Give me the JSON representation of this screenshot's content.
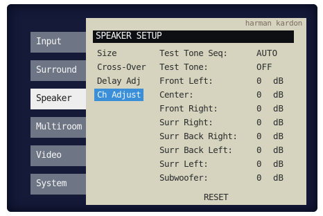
{
  "sidebar": {
    "items": [
      {
        "label": "Input"
      },
      {
        "label": "Surround"
      },
      {
        "label": "Speaker"
      },
      {
        "label": "Multiroom"
      },
      {
        "label": "Video"
      },
      {
        "label": "System"
      }
    ]
  },
  "panel": {
    "brand": "harman kardon",
    "title": "SPEAKER SETUP",
    "submenu": [
      {
        "label": "Size"
      },
      {
        "label": "Cross-Over"
      },
      {
        "label": "Delay Adj"
      },
      {
        "label": "Ch Adjust"
      }
    ],
    "settings": [
      {
        "label": "Test Tone Seq:",
        "value": "AUTO",
        "unit": ""
      },
      {
        "label": "Test Tone:",
        "value": "OFF",
        "unit": ""
      },
      {
        "label": "Front Left:",
        "value": "0",
        "unit": "dB"
      },
      {
        "label": "Center:",
        "value": "0",
        "unit": "dB"
      },
      {
        "label": "Front Right:",
        "value": "0",
        "unit": "dB"
      },
      {
        "label": "Surr Right:",
        "value": "0",
        "unit": "dB"
      },
      {
        "label": "Surr Back Right:",
        "value": "0",
        "unit": "dB"
      },
      {
        "label": "Surr Back Left:",
        "value": "0",
        "unit": "dB"
      },
      {
        "label": "Surr Left:",
        "value": "0",
        "unit": "dB"
      },
      {
        "label": "Subwoofer:",
        "value": "0",
        "unit": "dB"
      }
    ],
    "reset_label": "RESET"
  }
}
